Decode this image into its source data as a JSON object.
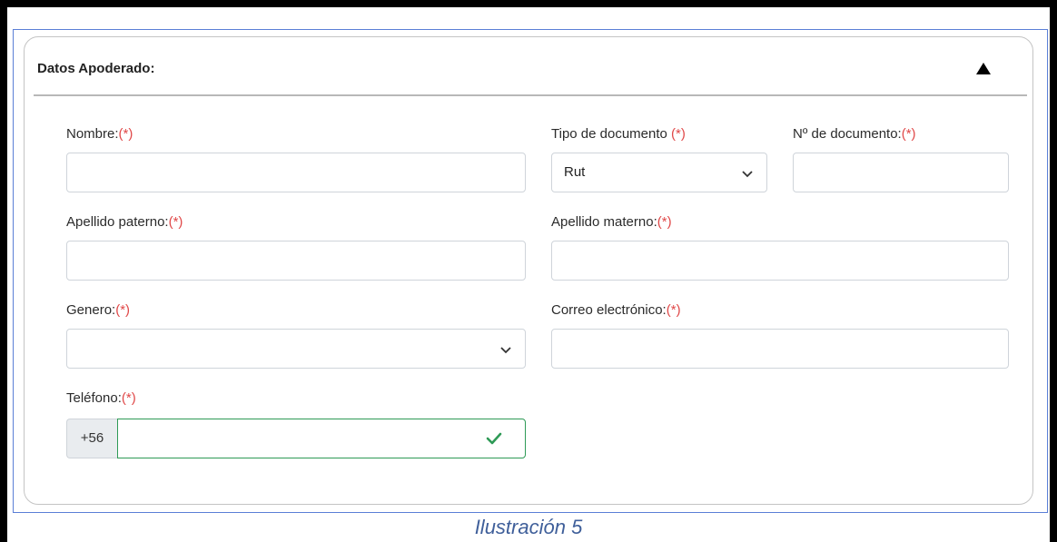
{
  "section": {
    "title": "Datos Apoderado:",
    "toggle_icon": "triangle-up-icon"
  },
  "fields": {
    "nombre": {
      "label": "Nombre:",
      "required": "(*)",
      "value": ""
    },
    "tipo_documento": {
      "label": "Tipo de documento ",
      "required": "(*)",
      "selected": "Rut"
    },
    "numero_documento": {
      "label": "Nº de documento:",
      "required": "(*)",
      "value": ""
    },
    "apellido_paterno": {
      "label": "Apellido paterno:",
      "required": "(*)",
      "value": ""
    },
    "apellido_materno": {
      "label": "Apellido materno:",
      "required": "(*)",
      "value": ""
    },
    "genero": {
      "label": "Genero:",
      "required": "(*)",
      "selected": ""
    },
    "correo": {
      "label": "Correo electrónico:",
      "required": "(*)",
      "value": ""
    },
    "telefono": {
      "label": "Teléfono:",
      "required": "(*)",
      "prefix": "+56",
      "value": "",
      "valid_icon": "checkmark-icon"
    }
  },
  "caption": "Ilustración 5",
  "colors": {
    "required": "#e04848",
    "valid": "#2e9a56",
    "caption": "#3f5f9a"
  }
}
